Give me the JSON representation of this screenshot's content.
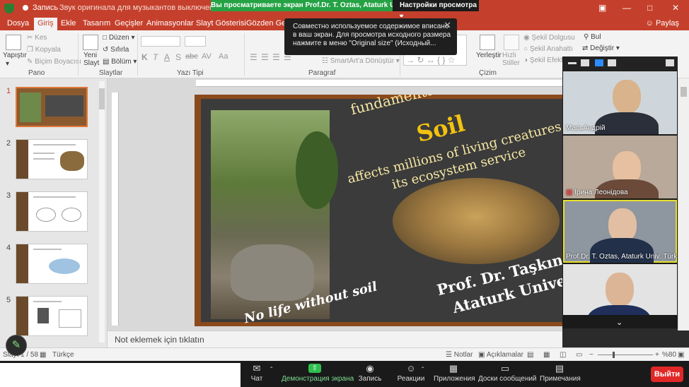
{
  "titlebar": {
    "record_label": "Запись",
    "sound_status": "Звук оригинала для музыкантов выключен",
    "share_banner": "Вы просматриваете экран Prof.Dr. T. Oztas, Ataturk Uni...",
    "view_settings": "Настройки просмотра",
    "window_controls": [
      "restore-icon",
      "minimize-icon",
      "maximize-icon",
      "close-icon"
    ]
  },
  "ribbon_tabs": [
    "Dosya",
    "Giriş",
    "Ekle",
    "Tasarım",
    "Geçişler",
    "Animasyonlar",
    "Slayt Gösterisi",
    "Gözden Geçir"
  ],
  "active_tab": "Giriş",
  "share_button": "Paylaş",
  "ribbon": {
    "clipboard": {
      "paste": "Yapıştır",
      "cut": "Kes",
      "copy": "Kopyala",
      "format_painter": "Biçim Boyacısı",
      "group": "Pano"
    },
    "slides": {
      "new_slide": "Yeni Slayt",
      "layout": "Düzen",
      "reset": "Sıfırla",
      "section": "Bölüm",
      "group": "Slaytlar"
    },
    "font": {
      "bold": "K",
      "italic": "T",
      "underline": "A",
      "strike": "S",
      "case": "abc",
      "spacing": "AV",
      "aa": "Aa",
      "group": "Yazı Tipi"
    },
    "paragraph": {
      "smartart": "SmartArt'a Dönüştür",
      "group": "Paragraf"
    },
    "drawing": {
      "arrange": "Yerleştir",
      "quick_styles": "Hızlı Stiller",
      "shape_fill": "Şekil Dolgusu",
      "shape_outline": "Şekil Anahattı",
      "shape_effects": "Şekil Efekt",
      "group": "Çizim"
    },
    "editing": {
      "find": "Bul",
      "replace": "Değiştir"
    }
  },
  "toast": {
    "line1": "Совместно используемое содержимое вписано",
    "line2": "в ваш экран. Для просмотра исходного размера",
    "line3": "нажмите в меню \"Original size\" (Исходный..."
  },
  "thumbnails": [
    "1",
    "2",
    "3",
    "4",
    "5"
  ],
  "selected_slide": "1",
  "slide": {
    "line1": "fundamental source of life",
    "line2": "Soil",
    "line3": "affects millions of living creatures with",
    "line4": "its ecosystem service",
    "line5": "Prof. Dr. Taşkın Özt",
    "line6": "Ataturk Universit",
    "line7": "No life without soil"
  },
  "notes_placeholder": "Not eklemek için tıklatın",
  "statusbar": {
    "slide_counter": "Slayt 1 / 58",
    "language": "Türkçe",
    "notes": "Notlar",
    "comments": "Açıklamalar",
    "zoom": "%80",
    "zoom_minus": "−",
    "zoom_plus": "+"
  },
  "participants": [
    {
      "name": "МасьАндрій"
    },
    {
      "name": "Ірина Леонідова"
    },
    {
      "name": "Prof.Dr. T. Oztas, Ataturk Univ. Türki..."
    },
    {
      "name": ""
    }
  ],
  "meeting_bar": [
    {
      "label": "Чат",
      "icon": "chat-icon"
    },
    {
      "label": "Демонстрация экрана",
      "icon": "share-screen-icon"
    },
    {
      "label": "Запись",
      "icon": "record-icon"
    },
    {
      "label": "Реакции",
      "icon": "reactions-icon"
    },
    {
      "label": "Приложения",
      "icon": "apps-icon"
    },
    {
      "label": "Доски сообщений",
      "icon": "whiteboard-icon"
    },
    {
      "label": "Примечания",
      "icon": "notes-icon"
    }
  ],
  "leave_button": "Выйти",
  "colors": {
    "accent": "#c5402c",
    "share_green": "#25a244",
    "leave_red": "#e02828"
  }
}
